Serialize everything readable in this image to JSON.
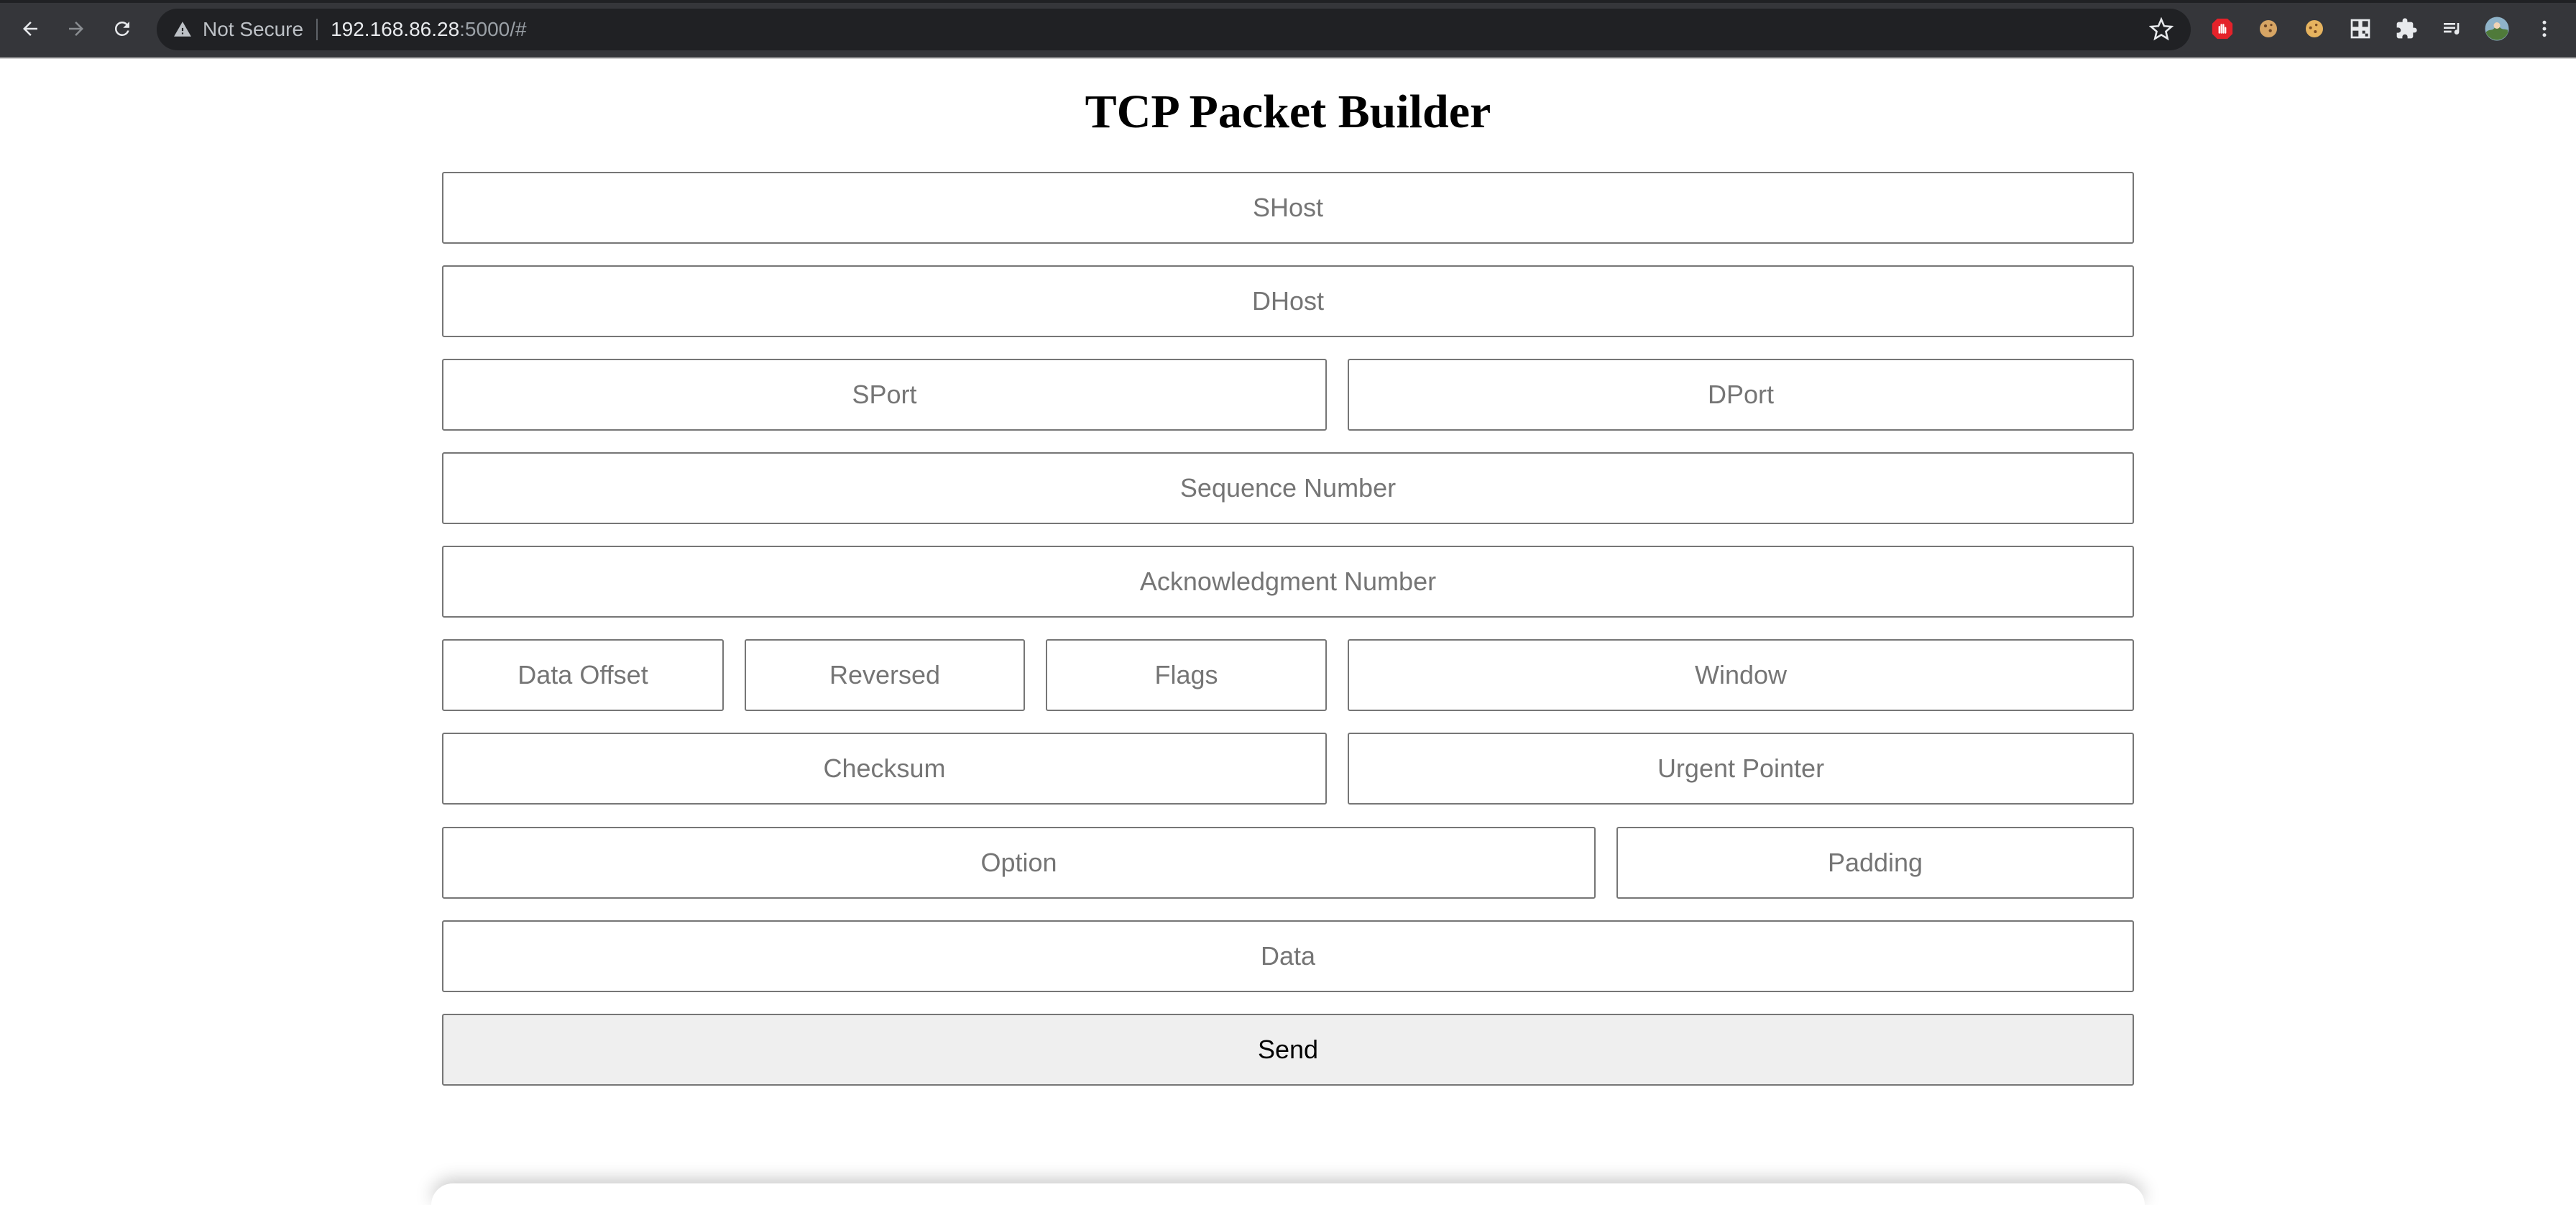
{
  "browser": {
    "security_label": "Not Secure",
    "url_host": "192.168.86.28",
    "url_rest": ":5000/#"
  },
  "page": {
    "title": "TCP Packet Builder"
  },
  "form": {
    "shost": {
      "placeholder": "SHost",
      "value": ""
    },
    "dhost": {
      "placeholder": "DHost",
      "value": ""
    },
    "sport": {
      "placeholder": "SPort",
      "value": ""
    },
    "dport": {
      "placeholder": "DPort",
      "value": ""
    },
    "seq": {
      "placeholder": "Sequence Number",
      "value": ""
    },
    "ack": {
      "placeholder": "Acknowledgment Number",
      "value": ""
    },
    "data_offset": {
      "placeholder": "Data Offset",
      "value": ""
    },
    "reversed": {
      "placeholder": "Reversed",
      "value": ""
    },
    "flags": {
      "placeholder": "Flags",
      "value": ""
    },
    "window": {
      "placeholder": "Window",
      "value": ""
    },
    "checksum": {
      "placeholder": "Checksum",
      "value": ""
    },
    "urgent_pointer": {
      "placeholder": "Urgent Pointer",
      "value": ""
    },
    "option": {
      "placeholder": "Option",
      "value": ""
    },
    "padding": {
      "placeholder": "Padding",
      "value": ""
    },
    "data": {
      "placeholder": "Data",
      "value": ""
    },
    "send_label": "Send"
  },
  "icons": {
    "back": "arrow-left-icon",
    "forward": "arrow-right-icon",
    "reload": "reload-icon",
    "warning": "warning-triangle-icon",
    "bookmark": "star-icon",
    "extensions": [
      "adblock-icon",
      "cookie-icon",
      "cookie-alt-icon",
      "qr-code-icon",
      "puzzle-icon",
      "reading-list-icon",
      "profile-avatar",
      "menu-kebab-icon"
    ]
  },
  "colors": {
    "chrome_bg": "#35363a",
    "omnibox_bg": "#202124",
    "button_bg": "#efefef",
    "field_border": "#767676"
  }
}
